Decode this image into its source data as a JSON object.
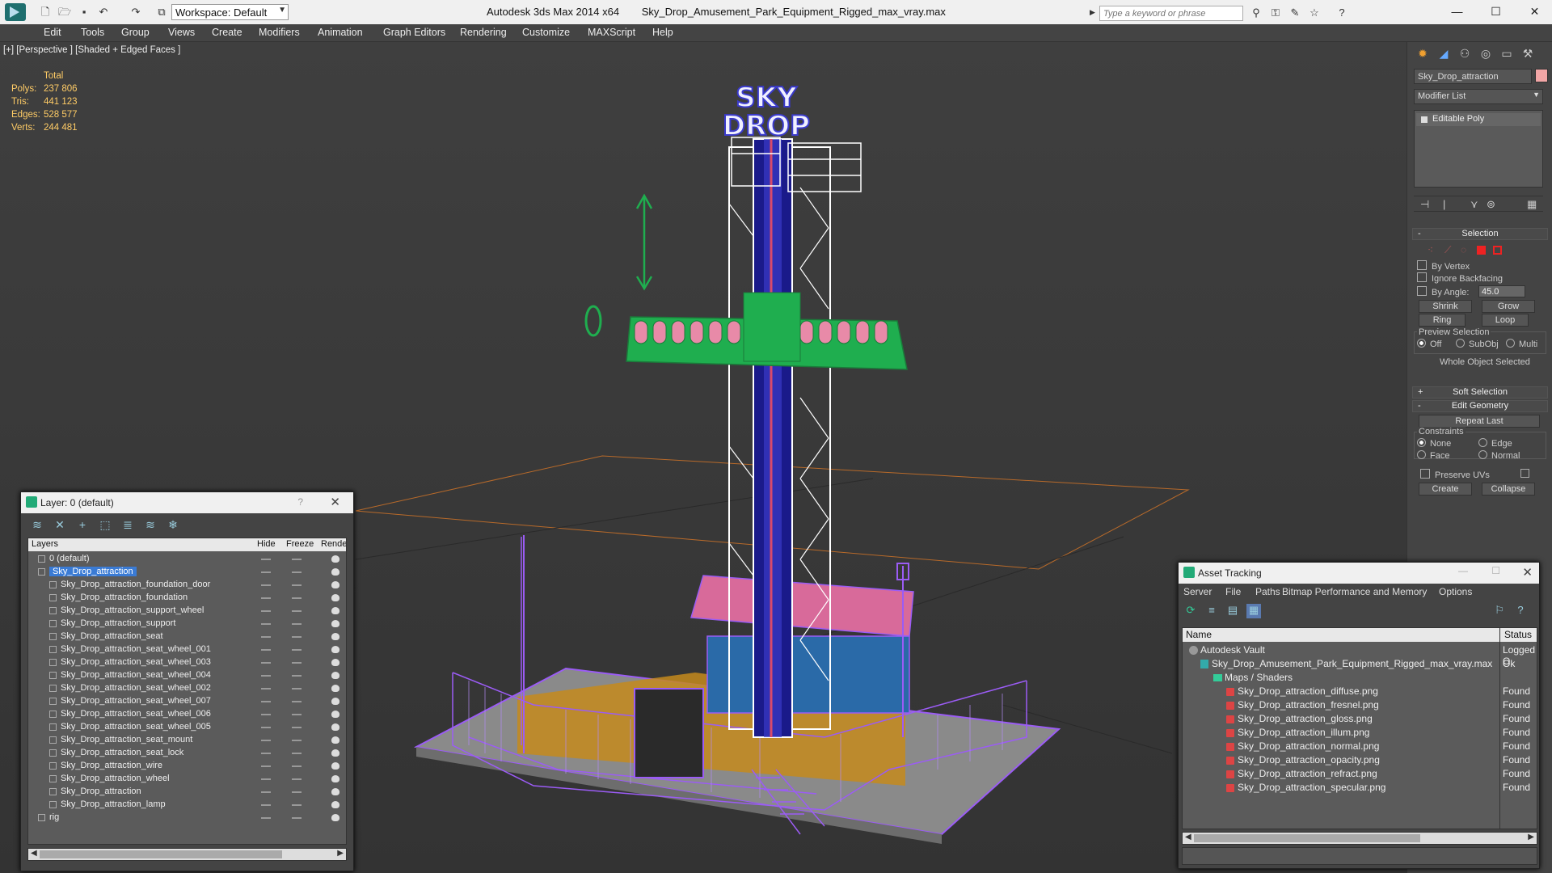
{
  "titlebar": {
    "workspace": "Workspace: Default",
    "app_name": "Autodesk 3ds Max  2014 x64",
    "file_name": "Sky_Drop_Amusement_Park_Equipment_Rigged_max_vray.max",
    "search_placeholder": "Type a keyword or phrase",
    "minimize": "—",
    "maximize": "☐",
    "close": "✕"
  },
  "menu": [
    "Edit",
    "Tools",
    "Group",
    "Views",
    "Create",
    "Modifiers",
    "Animation",
    "Graph Editors",
    "Rendering",
    "Customize",
    "MAXScript",
    "Help"
  ],
  "viewport": {
    "label": "[+] [Perspective ] [Shaded + Edged Faces ]",
    "stats": {
      "header": "Total",
      "rows": [
        {
          "label": "Polys:",
          "value": "237 806"
        },
        {
          "label": "Tris:",
          "value": "441 123"
        },
        {
          "label": "Edges:",
          "value": "528 577"
        },
        {
          "label": "Verts:",
          "value": "244 481"
        }
      ]
    },
    "sign_line1": "SKY",
    "sign_line2": "DROP"
  },
  "command_panel": {
    "object_name": "Sky_Drop_attraction",
    "modifier_list": "Modifier List",
    "stack_item": "Editable Poly",
    "selection": {
      "title": "Selection",
      "by_vertex": "By Vertex",
      "ignore_backfacing": "Ignore Backfacing",
      "by_angle": "By Angle:",
      "angle_value": "45.0",
      "shrink": "Shrink",
      "grow": "Grow",
      "ring": "Ring",
      "loop": "Loop",
      "preview_selection": "Preview Selection",
      "off": "Off",
      "subobj": "SubObj",
      "multi": "Multi",
      "status": "Whole Object Selected"
    },
    "soft_selection": "Soft Selection",
    "edit_geometry": {
      "title": "Edit Geometry",
      "repeat_last": "Repeat Last",
      "constraints": "Constraints",
      "none": "None",
      "edge": "Edge",
      "face": "Face",
      "normal": "Normal",
      "preserve_uvs": "Preserve UVs",
      "create": "Create",
      "collapse": "Collapse"
    }
  },
  "layer_dialog": {
    "title": "Layer: 0 (default)",
    "help": "?",
    "columns": {
      "layers": "Layers",
      "hide": "Hide",
      "freeze": "Freeze",
      "render": "Rende"
    },
    "rows": [
      {
        "name": "0 (default)",
        "level": 1
      },
      {
        "name": "Sky_Drop_attraction",
        "level": 1,
        "selected": true
      },
      {
        "name": "Sky_Drop_attraction_foundation_door",
        "level": 2
      },
      {
        "name": "Sky_Drop_attraction_foundation",
        "level": 2
      },
      {
        "name": "Sky_Drop_attraction_support_wheel",
        "level": 2
      },
      {
        "name": "Sky_Drop_attraction_support",
        "level": 2
      },
      {
        "name": "Sky_Drop_attraction_seat",
        "level": 2
      },
      {
        "name": "Sky_Drop_attraction_seat_wheel_001",
        "level": 2
      },
      {
        "name": "Sky_Drop_attraction_seat_wheel_003",
        "level": 2
      },
      {
        "name": "Sky_Drop_attraction_seat_wheel_004",
        "level": 2
      },
      {
        "name": "Sky_Drop_attraction_seat_wheel_002",
        "level": 2
      },
      {
        "name": "Sky_Drop_attraction_seat_wheel_007",
        "level": 2
      },
      {
        "name": "Sky_Drop_attraction_seat_wheel_006",
        "level": 2
      },
      {
        "name": "Sky_Drop_attraction_seat_wheel_005",
        "level": 2
      },
      {
        "name": "Sky_Drop_attraction_seat_mount",
        "level": 2
      },
      {
        "name": "Sky_Drop_attraction_seat_lock",
        "level": 2
      },
      {
        "name": "Sky_Drop_attraction_wire",
        "level": 2
      },
      {
        "name": "Sky_Drop_attraction_wheel",
        "level": 2
      },
      {
        "name": "Sky_Drop_attraction",
        "level": 2
      },
      {
        "name": "Sky_Drop_attraction_lamp",
        "level": 2
      },
      {
        "name": "rig",
        "level": 1
      }
    ]
  },
  "asset_tracking": {
    "title": "Asset Tracking",
    "menu": [
      "Server",
      "File",
      "Paths",
      "Bitmap Performance and Memory",
      "Options"
    ],
    "columns": {
      "name": "Name",
      "status": "Status"
    },
    "rows": [
      {
        "name": "Autodesk Vault",
        "status": "Logged O",
        "kind": "vault",
        "indent": 22
      },
      {
        "name": "Sky_Drop_Amusement_Park_Equipment_Rigged_max_vray.max",
        "status": "Ok",
        "kind": "max",
        "indent": 36
      },
      {
        "name": "Maps / Shaders",
        "status": "",
        "kind": "folder",
        "indent": 52
      },
      {
        "name": "Sky_Drop_attraction_diffuse.png",
        "status": "Found",
        "kind": "png",
        "indent": 68
      },
      {
        "name": "Sky_Drop_attraction_fresnel.png",
        "status": "Found",
        "kind": "png",
        "indent": 68
      },
      {
        "name": "Sky_Drop_attraction_gloss.png",
        "status": "Found",
        "kind": "png",
        "indent": 68
      },
      {
        "name": "Sky_Drop_attraction_illum.png",
        "status": "Found",
        "kind": "png",
        "indent": 68
      },
      {
        "name": "Sky_Drop_attraction_normal.png",
        "status": "Found",
        "kind": "png",
        "indent": 68
      },
      {
        "name": "Sky_Drop_attraction_opacity.png",
        "status": "Found",
        "kind": "png",
        "indent": 68
      },
      {
        "name": "Sky_Drop_attraction_refract.png",
        "status": "Found",
        "kind": "png",
        "indent": 68
      },
      {
        "name": "Sky_Drop_attraction_specular.png",
        "status": "Found",
        "kind": "png",
        "indent": 68
      }
    ]
  },
  "colors": {
    "stats_text": "#ffcc66",
    "selection_blue": "#3a7bd5",
    "wireframe_purple": "#9b5cf5",
    "tower_white": "#ffffff",
    "gizmo_green": "#1fae4f"
  }
}
